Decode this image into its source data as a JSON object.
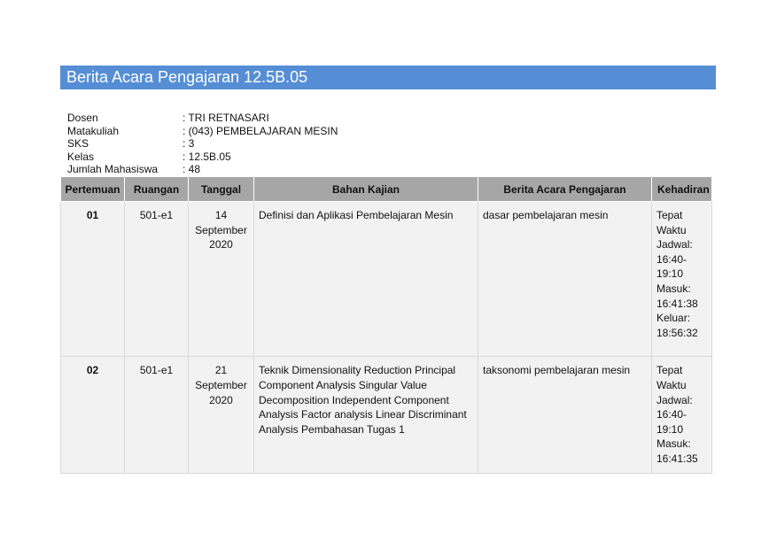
{
  "title": "Berita Acara Pengajaran 12.5B.05",
  "info": [
    {
      "label": "Dosen",
      "value": ": TRI RETNASARI"
    },
    {
      "label": "Matakuliah",
      "value": ": (043) PEMBELAJARAN MESIN"
    },
    {
      "label": "SKS",
      "value": ": 3"
    },
    {
      "label": "Kelas",
      "value": ": 12.5B.05"
    },
    {
      "label": "Jumlah Mahasiswa",
      "value": ": 48"
    }
  ],
  "table": {
    "headers": [
      "Pertemuan",
      "Ruangan",
      "Tanggal",
      "Bahan Kajian",
      "Berita Acara Pengajaran",
      "Kehadiran"
    ],
    "rows": [
      {
        "pertemuan": "01",
        "ruangan": "501-e1",
        "tanggal": "14 September 2020",
        "bahan": "Definisi dan Aplikasi Pembelajaran Mesin",
        "berita": "dasar pembelajaran mesin",
        "kehadiran": [
          "Tepat",
          "Waktu",
          "Jadwal:",
          "16:40-",
          "19:10",
          "Masuk:",
          "16:41:38",
          "Keluar:",
          "18:56:32"
        ]
      },
      {
        "pertemuan": "02",
        "ruangan": "501-e1",
        "tanggal": "21 September 2020",
        "bahan": "Teknik Dimensionality Reduction Principal Component Analysis Singular Value Decomposition Independent Component Analysis Factor analysis Linear Discriminant Analysis Pembahasan Tugas 1",
        "berita": "taksonomi pembelajaran mesin",
        "kehadiran": [
          "Tepat",
          "Waktu",
          "Jadwal:",
          "16:40-",
          "19:10",
          "Masuk:",
          "16:41:35"
        ]
      }
    ]
  }
}
